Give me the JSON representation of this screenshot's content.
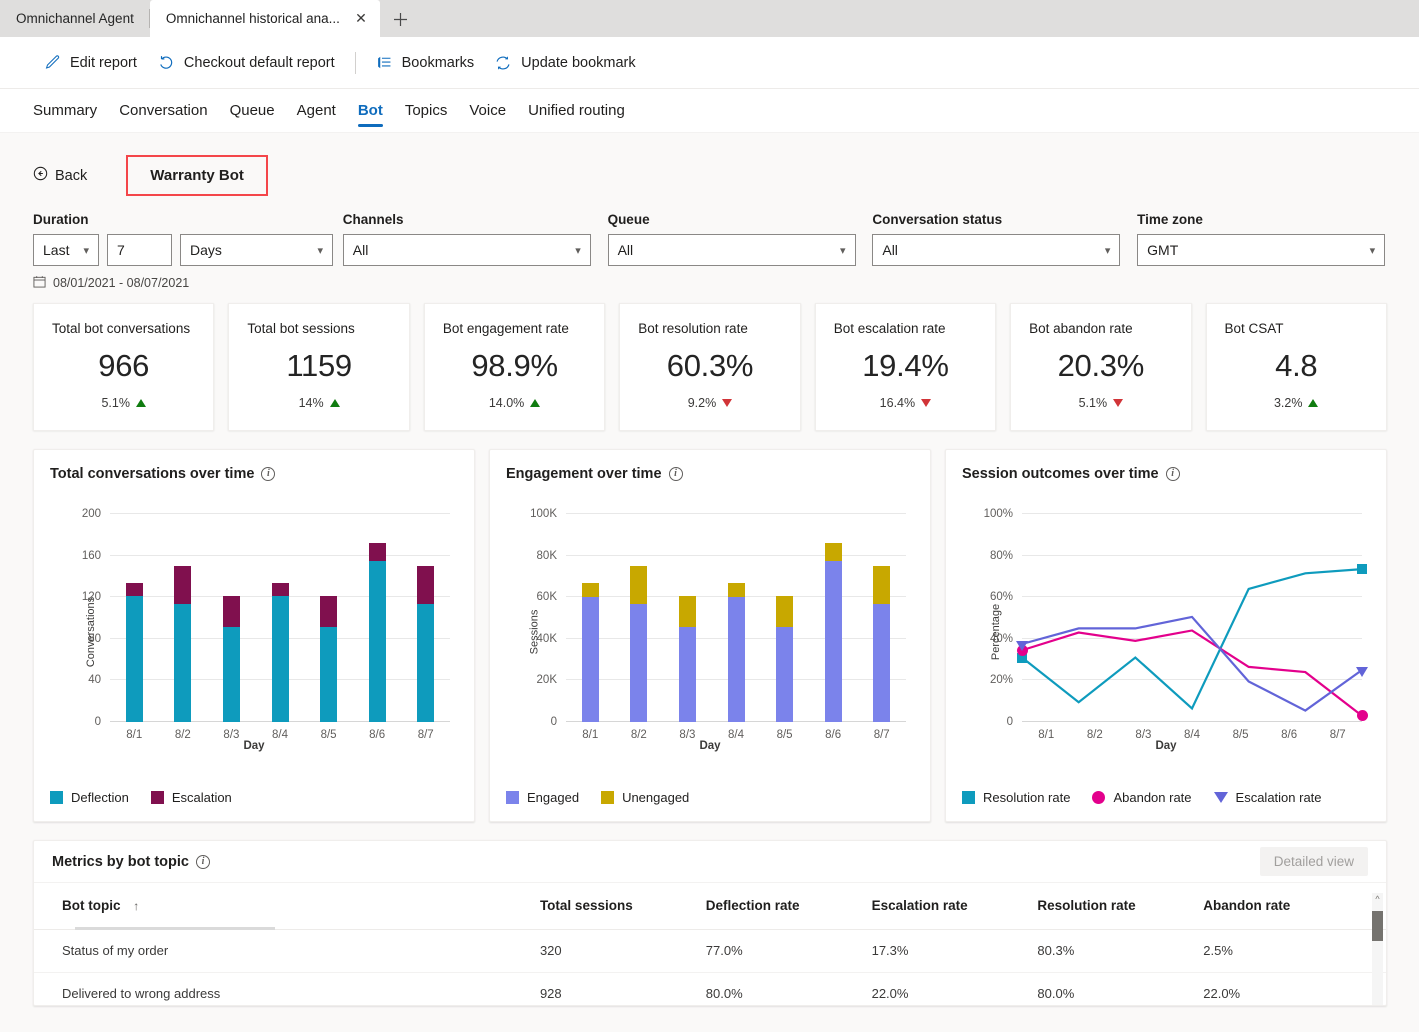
{
  "browser": {
    "tabs": [
      {
        "label": "Omnichannel Agent",
        "active": false
      },
      {
        "label": "Omnichannel historical ana...",
        "active": true
      }
    ],
    "close_icon": "✕",
    "new_tab_icon": "＋"
  },
  "toolbar": {
    "items": [
      {
        "label": "Edit report",
        "icon": "pencil-icon"
      },
      {
        "label": "Checkout default report",
        "icon": "undo-icon"
      },
      {
        "label": "Bookmarks",
        "icon": "bookmark-list-icon"
      },
      {
        "label": "Update bookmark",
        "icon": "refresh-icon"
      }
    ],
    "accent": "#0f6cbd"
  },
  "pivots": [
    {
      "label": "Summary",
      "selected": false
    },
    {
      "label": "Conversation",
      "selected": false
    },
    {
      "label": "Queue",
      "selected": false
    },
    {
      "label": "Agent",
      "selected": false
    },
    {
      "label": "Bot",
      "selected": true
    },
    {
      "label": "Topics",
      "selected": false
    },
    {
      "label": "Voice",
      "selected": false
    },
    {
      "label": "Unified routing",
      "selected": false
    }
  ],
  "back": {
    "label": "Back",
    "icon": "back-circle-icon"
  },
  "bot_name": "Warranty Bot",
  "highlight_color": "#f4464a",
  "filters": {
    "duration": {
      "label": "Duration",
      "mode": "Last",
      "amount": "7",
      "unit": "Days"
    },
    "channels": {
      "label": "Channels",
      "value": "All"
    },
    "queue": {
      "label": "Queue",
      "value": "All"
    },
    "conversation_status": {
      "label": "Conversation status",
      "value": "All"
    },
    "time_zone": {
      "label": "Time zone",
      "value": "GMT"
    },
    "date_range": "08/01/2021 - 08/07/2021",
    "calendar_icon": "calendar-icon",
    "chevron_icon": "chevron-down-icon"
  },
  "kpis": [
    {
      "title": "Total bot conversations",
      "value": "966",
      "delta": "5.1%",
      "dir": "up"
    },
    {
      "title": "Total bot sessions",
      "value": "1159",
      "delta": "14%",
      "dir": "up"
    },
    {
      "title": "Bot engagement rate",
      "value": "98.9%",
      "delta": "14.0%",
      "dir": "up"
    },
    {
      "title": "Bot resolution rate",
      "value": "60.3%",
      "delta": "9.2%",
      "dir": "down"
    },
    {
      "title": "Bot escalation rate",
      "value": "19.4%",
      "delta": "16.4%",
      "dir": "down"
    },
    {
      "title": "Bot abandon rate",
      "value": "20.3%",
      "delta": "5.1%",
      "dir": "down"
    },
    {
      "title": "Bot CSAT",
      "value": "4.8",
      "delta": "3.2%",
      "dir": "up"
    }
  ],
  "chart_data": [
    {
      "type": "bar",
      "stacked": true,
      "title": "Total conversations over time",
      "xlabel": "Day",
      "ylabel": "Conversations",
      "categories": [
        "8/1",
        "8/2",
        "8/3",
        "8/4",
        "8/5",
        "8/6",
        "8/7"
      ],
      "yticks": [
        0,
        40,
        80,
        120,
        160,
        200
      ],
      "ylim": [
        0,
        200
      ],
      "grid": true,
      "legend_position": "bottom-left",
      "series": [
        {
          "name": "Deflection",
          "color": "#0e9bbd",
          "values": [
            121,
            113,
            91,
            121,
            91,
            155,
            113
          ]
        },
        {
          "name": "Escalation",
          "color": "#80104e",
          "values": [
            13,
            37,
            30,
            13,
            30,
            17,
            37
          ]
        }
      ],
      "totals": [
        134,
        150,
        121,
        134,
        121,
        172,
        150
      ]
    },
    {
      "type": "bar",
      "stacked": true,
      "title": "Engagement over time",
      "xlabel": "Day",
      "ylabel": "Sessions",
      "categories": [
        "8/1",
        "8/2",
        "8/3",
        "8/4",
        "8/5",
        "8/6",
        "8/7"
      ],
      "yticks": [
        "0",
        "20K",
        "40K",
        "60K",
        "80K",
        "100K"
      ],
      "ylim": [
        0,
        100000
      ],
      "grid": true,
      "legend_position": "bottom-left",
      "series": [
        {
          "name": "Engaged",
          "color": "#7b83eb",
          "values": [
            60000,
            56500,
            45500,
            60000,
            45500,
            77500,
            56500
          ]
        },
        {
          "name": "Unengaged",
          "color": "#c8a800",
          "values": [
            7000,
            18500,
            15000,
            7000,
            15000,
            8500,
            18500
          ]
        }
      ],
      "totals": [
        67000,
        75000,
        60500,
        67000,
        60500,
        86000,
        75000
      ]
    },
    {
      "type": "line",
      "title": "Session outcomes over time",
      "xlabel": "Day",
      "ylabel": "Percentage",
      "categories": [
        "8/1",
        "8/2",
        "8/3",
        "8/4",
        "8/5",
        "8/6",
        "8/7"
      ],
      "yticks": [
        "0",
        "20%",
        "40%",
        "60%",
        "80%",
        "100%"
      ],
      "ylim": [
        0,
        100
      ],
      "grid": true,
      "legend_position": "bottom-left",
      "series": [
        {
          "name": "Resolution rate",
          "color": "#0e9bbd",
          "marker": "square",
          "values": [
            31,
            9.5,
            31,
            6.5,
            64,
            71.5,
            73.5
          ]
        },
        {
          "name": "Abandon rate",
          "color": "#e3008c",
          "marker": "circle",
          "values": [
            34.5,
            43,
            39,
            44,
            26.5,
            24,
            3
          ]
        },
        {
          "name": "Escalation rate",
          "color": "#6264d8",
          "marker": "triangle",
          "values": [
            37.5,
            45,
            45,
            50.5,
            19.5,
            5.5,
            25
          ]
        }
      ]
    }
  ],
  "table": {
    "title": "Metrics by bot topic",
    "detailed_view_label": "Detailed view",
    "sort_column": "Bot topic",
    "sort_direction": "ascending",
    "sort_icon": "arrow-up-icon",
    "columns": [
      "Bot topic",
      "Total sessions",
      "Deflection rate",
      "Escalation rate",
      "Resolution rate",
      "Abandon rate"
    ],
    "rows": [
      {
        "topic": "Status of my order",
        "total_sessions": "320",
        "deflection_rate": "77.0%",
        "escalation_rate": "17.3%",
        "resolution_rate": "80.3%",
        "abandon_rate": "2.5%"
      },
      {
        "topic": "Delivered to wrong address",
        "total_sessions": "928",
        "deflection_rate": "80.0%",
        "escalation_rate": "22.0%",
        "resolution_rate": "80.0%",
        "abandon_rate": "22.0%"
      }
    ]
  }
}
